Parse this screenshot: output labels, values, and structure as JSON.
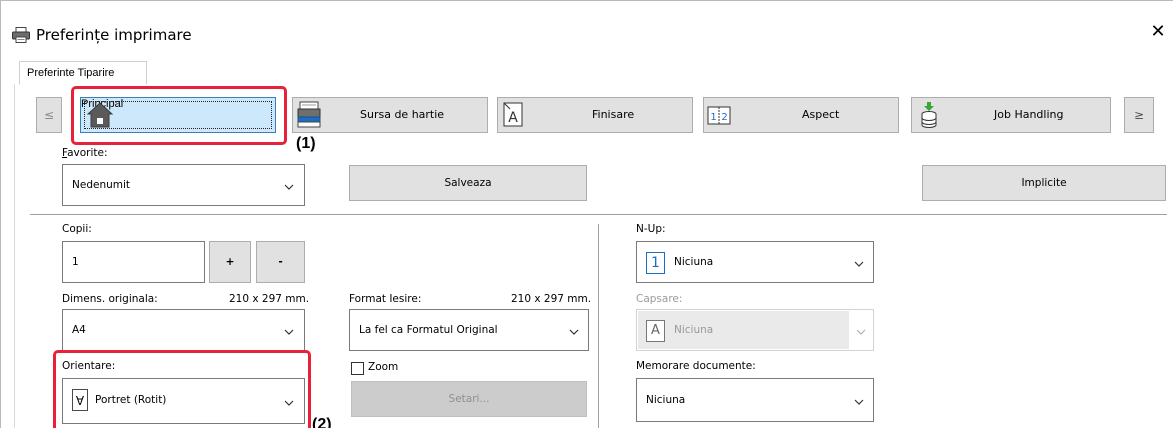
{
  "window": {
    "title": "Preferințe imprimare",
    "close_glyph": "✕",
    "icon": "printer-icon"
  },
  "tabs": [
    {
      "label": "Preferinte Tiparire",
      "selected": true
    }
  ],
  "nav": {
    "scroll_left": "≤",
    "scroll_right": "≥",
    "items": [
      {
        "label": "Principal",
        "icon": "home-icon",
        "selected": true
      },
      {
        "label": "Sursa de hartie",
        "icon": "paper-tray-icon"
      },
      {
        "label": "Finisare",
        "icon": "finishing-icon"
      },
      {
        "label": "Aspect",
        "icon": "layout-icon"
      },
      {
        "label": "Job Handling",
        "icon": "job-handling-icon"
      }
    ]
  },
  "callouts": {
    "first": "(1)",
    "second": "(2)"
  },
  "favorites": {
    "label": "Favorite:",
    "value": "Nedenumit",
    "save_label": "Salveaza",
    "defaults_label": "Implicite"
  },
  "copies": {
    "label": "Copii:",
    "value": "1",
    "plus": "+",
    "minus": "-"
  },
  "original_size": {
    "label": "Dimens. originala:",
    "dims": "210 x 297 mm.",
    "value": "A4"
  },
  "output_format": {
    "label": "Format Iesire:",
    "dims": "210 x 297 mm.",
    "value": "La fel ca Formatul Original"
  },
  "orientation": {
    "label": "Orientare:",
    "value": "Portret (Rotit)",
    "icon_glyph": "A"
  },
  "zoom": {
    "label": "Zoom",
    "checked": false,
    "settings_label": "Setari..."
  },
  "nup": {
    "label": "N-Up:",
    "value": "Niciuna",
    "icon_glyph": "1"
  },
  "staple": {
    "label": "Capsare:",
    "value": "Niciuna",
    "icon_glyph": "A",
    "disabled": true
  },
  "document_filing": {
    "label": "Memorare documente:",
    "value": "Niciuna"
  },
  "colors": {
    "selected_bg": "#cde8fb",
    "selected_border": "#3c7fb1",
    "highlight": "#e8213b",
    "button_bg": "#e1e1e1",
    "accent_blue": "#1a6fc4"
  }
}
